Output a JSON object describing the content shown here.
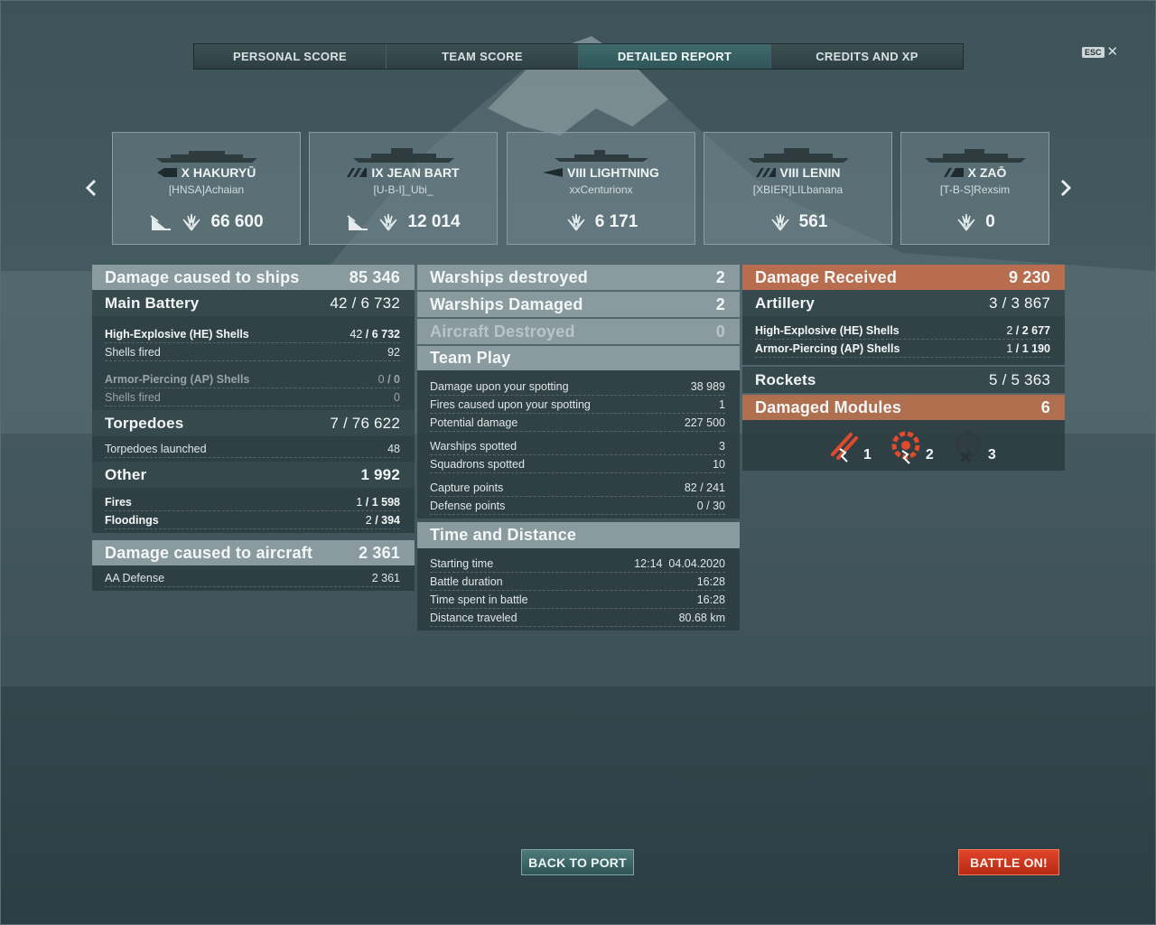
{
  "tabs": [
    {
      "label": "PERSONAL SCORE",
      "active": false
    },
    {
      "label": "TEAM SCORE",
      "active": false
    },
    {
      "label": "DETAILED REPORT",
      "active": true
    },
    {
      "label": "CREDITS AND XP",
      "active": false
    }
  ],
  "esc": {
    "key": "ESC",
    "close": "✕"
  },
  "ships": [
    {
      "tier_name": "X HAKURYŪ",
      "player": "[HNSA]Achaian",
      "damage": "66 600",
      "class_icon": "aircraft-carrier-icon",
      "sunk": true
    },
    {
      "tier_name": "IX JEAN BART",
      "player": "[U-B-I]_Ubi_",
      "damage": "12 014",
      "class_icon": "battleship-icon",
      "sunk": true
    },
    {
      "tier_name": "VIII LIGHTNING",
      "player": "xxCenturionx",
      "damage": "6 171",
      "class_icon": "destroyer-icon",
      "sunk": false
    },
    {
      "tier_name": "VIII LENIN",
      "player": "[XBIER]LILbanana",
      "damage": "561",
      "class_icon": "battleship-icon",
      "sunk": false
    },
    {
      "tier_name": "X ZAŌ",
      "player": "[T-B-S]Rexsim",
      "damage": "0",
      "class_icon": "cruiser-icon",
      "sunk": false
    }
  ],
  "left": {
    "damage_ships": {
      "label": "Damage caused to ships",
      "value": "85 346"
    },
    "main_battery": {
      "label": "Main Battery",
      "value": "42 / 6 732"
    },
    "he": {
      "label": "High-Explosive (HE) Shells",
      "hits": "42",
      "damage": "6 732"
    },
    "he_fired": {
      "label": "Shells fired",
      "value": "92"
    },
    "ap": {
      "label": "Armor-Piercing (AP) Shells",
      "hits": "0",
      "damage": "0"
    },
    "ap_fired": {
      "label": "Shells fired",
      "value": "0"
    },
    "torpedoes": {
      "label": "Torpedoes",
      "value": "7 / 76 622"
    },
    "torp_launched": {
      "label": "Torpedoes launched",
      "value": "48"
    },
    "other": {
      "label": "Other",
      "value": "1 992"
    },
    "fires": {
      "label": "Fires",
      "hits": "1",
      "damage": "1 598"
    },
    "floodings": {
      "label": "Floodings",
      "hits": "2",
      "damage": "394"
    },
    "damage_aircraft": {
      "label": "Damage caused to aircraft",
      "value": "2 361"
    },
    "aa": {
      "label": "AA Defense",
      "value": "2 361"
    }
  },
  "middle": {
    "destroyed": {
      "label": "Warships destroyed",
      "value": "2"
    },
    "damaged": {
      "label": "Warships Damaged",
      "value": "2"
    },
    "aircraft": {
      "label": "Aircraft Destroyed",
      "value": "0"
    },
    "team_play": {
      "label": "Team Play"
    },
    "spotting_dmg": {
      "label": "Damage upon your spotting",
      "value": "38 989"
    },
    "spotting_fires": {
      "label": "Fires caused upon your spotting",
      "value": "1"
    },
    "potential": {
      "label": "Potential damage",
      "value": "227 500"
    },
    "ships_spotted": {
      "label": "Warships spotted",
      "value": "3"
    },
    "squadrons": {
      "label": "Squadrons spotted",
      "value": "10"
    },
    "capture": {
      "label": "Capture points",
      "value": "82 / 241"
    },
    "defense": {
      "label": "Defense points",
      "value": "0 / 30"
    },
    "time": {
      "label": "Time and Distance"
    },
    "start": {
      "label": "Starting time",
      "value": "12:14  04.04.2020"
    },
    "duration": {
      "label": "Battle duration",
      "value": "16:28"
    },
    "spent": {
      "label": "Time spent in battle",
      "value": "16:28"
    },
    "distance": {
      "label": "Distance traveled",
      "value": "80.68 km"
    }
  },
  "right": {
    "received": {
      "label": "Damage Received",
      "value": "9 230"
    },
    "artillery": {
      "label": "Artillery",
      "value": "3 / 3 867"
    },
    "he": {
      "label": "High-Explosive (HE) Shells",
      "hits": "2",
      "damage": "2 677"
    },
    "ap": {
      "label": "Armor-Piercing (AP) Shells",
      "hits": "1",
      "damage": "1 190"
    },
    "rockets": {
      "label": "Rockets",
      "value": "5 / 5 363"
    },
    "modules": {
      "label": "Damaged Modules",
      "value": "6"
    },
    "module_icons": [
      {
        "icon": "torpedo-tubes-damaged-icon",
        "count": "1"
      },
      {
        "icon": "engine-damaged-icon",
        "count": "2"
      },
      {
        "icon": "aa-mount-destroyed-icon",
        "count": "3"
      }
    ]
  },
  "buttons": {
    "back": "BACK TO PORT",
    "battle": "BATTLE ON!"
  },
  "colors": {
    "tab_active": "#2f5658",
    "received_header": "#b86e4e",
    "battle_button": "#d23a20"
  }
}
